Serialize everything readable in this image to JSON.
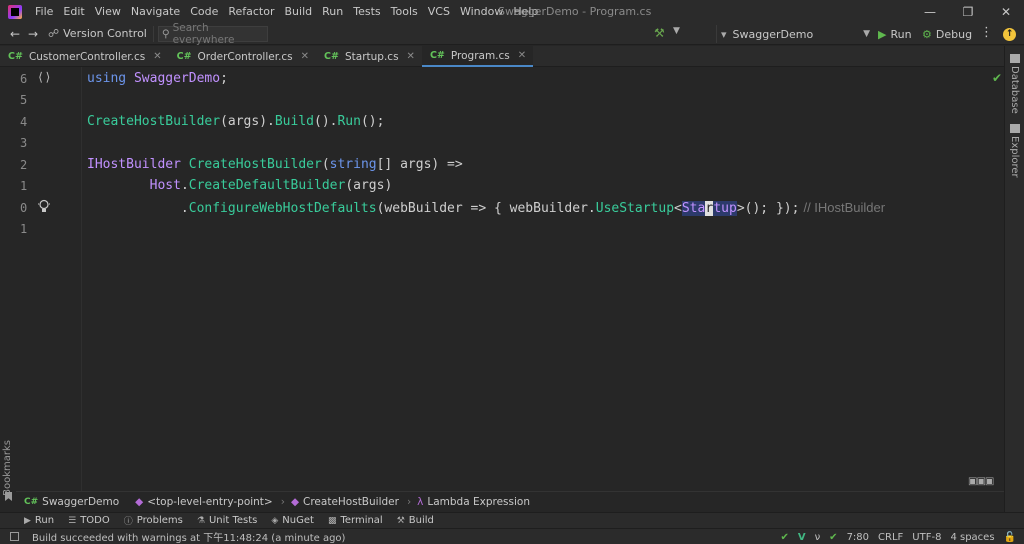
{
  "menu": [
    "File",
    "Edit",
    "View",
    "Navigate",
    "Code",
    "Refactor",
    "Build",
    "Run",
    "Tests",
    "Tools",
    "VCS",
    "Window",
    "Help"
  ],
  "window_title": "SwaggerDemo - Program.cs",
  "nav": {
    "vcs_label": "Version Control",
    "search_placeholder": "Search everywhere",
    "config_label": "SwaggerDemo",
    "run_label": "Run",
    "debug_label": "Debug"
  },
  "tabs": [
    {
      "lang": "C#",
      "label": "CustomerController.cs",
      "active": false
    },
    {
      "lang": "C#",
      "label": "OrderController.cs",
      "active": false
    },
    {
      "lang": "C#",
      "label": "Startup.cs",
      "active": false
    },
    {
      "lang": "C#",
      "label": "Program.cs",
      "active": true
    }
  ],
  "line_numbers": [
    "6",
    "5",
    "4",
    "3",
    "2",
    "1",
    "0",
    "1"
  ],
  "code": {
    "line1": {
      "kw": "using",
      "ns": "SwaggerDemo",
      "semi": ";"
    },
    "line3": {
      "fn1": "CreateHostBuilder",
      "a": "(args).",
      "fn2": "Build",
      "b": "().",
      "fn3": "Run",
      "c": "();"
    },
    "line5": {
      "ty1": "IHostBuilder",
      "fn": "CreateHostBuilder",
      "p1": "(",
      "kw": "string",
      "p2": "[] args) =>"
    },
    "line6": {
      "ty": "Host",
      "dot": ".",
      "fn": "CreateDefaultBuilder",
      "rest": "(args)"
    },
    "line7": {
      "dot": ".",
      "fn": "ConfigureWebHostDefaults",
      "a": "(webBuilder => { webBuilder.",
      "fn2": "UseStartup",
      "lt": "<",
      "ty_pre": "Sta",
      "caret_ch": "r",
      "ty_post": "tup",
      "gt": ">(); });",
      "hint": "// IHostBuilder"
    }
  },
  "right_tools": {
    "database": "Database",
    "explorer": "Explorer"
  },
  "left_tools": {
    "bookmarks": "Bookmarks"
  },
  "breadcrumb": [
    "SwaggerDemo",
    "<top-level-entry-point>",
    "CreateHostBuilder",
    "Lambda Expression"
  ],
  "tool_windows": [
    "Run",
    "TODO",
    "Problems",
    "Unit Tests",
    "NuGet",
    "Terminal",
    "Build"
  ],
  "status": {
    "message": "Build succeeded with warnings at 下午11:48:24 (a minute ago)",
    "position": "7:80",
    "line_sep": "CRLF",
    "encoding": "UTF-8",
    "indent": "4 spaces"
  },
  "colors": {
    "accent": "#4a88c7",
    "keyword": "#6c95eb",
    "type": "#c191ff",
    "method": "#39cc9b"
  }
}
